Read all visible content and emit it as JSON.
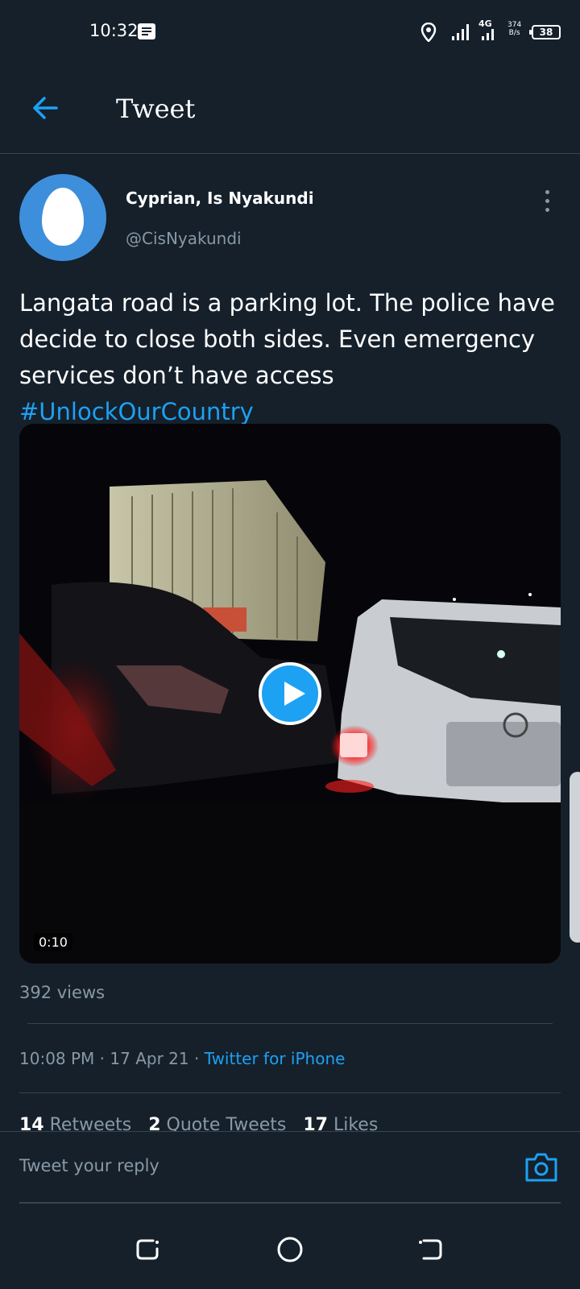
{
  "status_bar": {
    "time": "10:32",
    "network": "4G",
    "speed_value": "374",
    "speed_unit": "B/s",
    "battery": "38"
  },
  "header": {
    "title": "Tweet"
  },
  "author": {
    "display_name": "Cyprian, Is Nyakundi",
    "handle": "@CisNyakundi"
  },
  "tweet": {
    "text": "Langata road is a parking lot. The police have decide to close both sides. Even emergency services don’t have access ",
    "hashtag": "#UnlockOurCountry",
    "video_duration": "0:10",
    "views": "392 views",
    "timestamp": "10:08 PM · 17 Apr 21 · ",
    "source": "Twitter for iPhone"
  },
  "stats": {
    "retweets_count": "14",
    "retweets_label": "Retweets",
    "quote_count": "2",
    "quote_label": "Quote Tweets",
    "likes_count": "17",
    "likes_label": "Likes"
  },
  "reply": {
    "placeholder": "Tweet your reply"
  },
  "colors": {
    "background": "#15202b",
    "accent": "#1da1f2",
    "secondary_text": "#8899a6",
    "divider": "#38444d"
  },
  "icons": {
    "back": "arrow-left-icon",
    "more": "more-vertical-icon",
    "play": "play-icon",
    "camera": "camera-icon",
    "location": "location-pin-icon",
    "message": "message-notification-icon"
  }
}
